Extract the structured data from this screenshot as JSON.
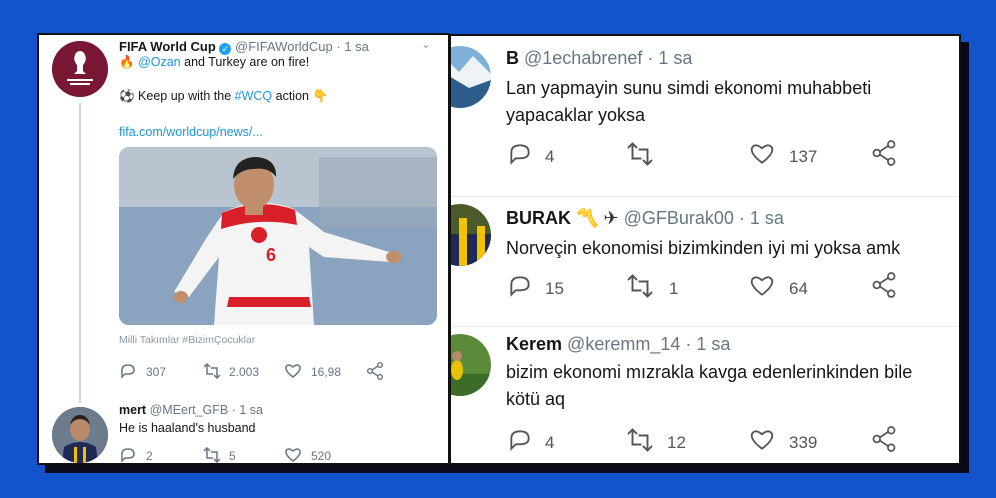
{
  "left": {
    "tweet": {
      "name": "FIFA World Cup",
      "handle": "@FIFAWorldCup",
      "time": "· 1 sa",
      "fire1": "🔥",
      "mention": "@Ozan",
      "line1_rest": " and Turkey are on fire!",
      "ball": "⚽",
      "line2_pre": " Keep up with the ",
      "hashtag": "#WCQ",
      "line2_post": " action 👇",
      "link": "fifa.com/worldcup/news/...",
      "jersey_number": "6",
      "caption": "Milli Takımlar #BizimÇocuklar",
      "replies": "307",
      "retweets": "2.003",
      "likes": "16,98"
    },
    "reply": {
      "name": "mert",
      "handle": "@MEert_GFB",
      "time": "· 1 sa",
      "text": "He is haaland's husband",
      "replies": "2",
      "retweets": "5",
      "likes": "520"
    }
  },
  "right": {
    "tweets": [
      {
        "name": "B",
        "handle": "@1echabrenef",
        "time": "· 1 sa",
        "lines": [
          "Lan yapmayin sunu simdi ekonomi muhabbeti",
          "yapacaklar yoksa"
        ],
        "replies": "4",
        "retweets": "",
        "likes": "137"
      },
      {
        "name": "BURAK",
        "emoji": "〽️",
        "plane": "✈",
        "handle": "@GFBurak00",
        "time": "· 1 sa",
        "lines": [
          "Norveçin ekonomisi bizimkinden iyi mi yoksa amk"
        ],
        "replies": "15",
        "retweets": "1",
        "likes": "64"
      },
      {
        "name": "Kerem",
        "handle": "@keremm_14",
        "time": "· 1 sa",
        "lines": [
          "bizim ekonomi mızrakla kavga edenlerinkinden bile",
          "kötü aq"
        ],
        "replies": "4",
        "retweets": "12",
        "likes": "339"
      }
    ]
  },
  "colors": {
    "background": "#1353cc",
    "link": "#1b95e0",
    "muted": "#657786"
  }
}
